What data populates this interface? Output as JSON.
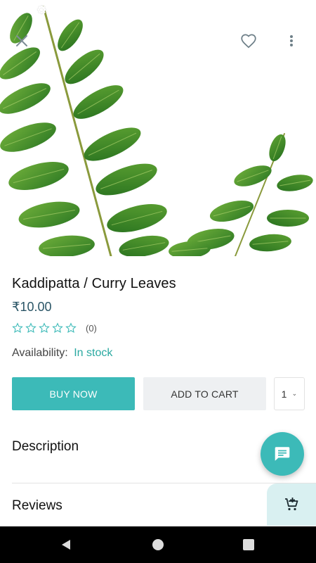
{
  "product": {
    "title": "Kaddipatta / Curry Leaves",
    "price": "₹10.00",
    "rating_count": "(0)",
    "rating_value": 0,
    "rating_max": 5,
    "availability_label": "Availability:",
    "availability_status": "In stock"
  },
  "actions": {
    "buy_now": "BUY NOW",
    "add_to_cart": "ADD TO CART",
    "quantity": "1"
  },
  "sections": {
    "description": "Description",
    "reviews": "Reviews"
  },
  "icons": {
    "top_left": "settings-icon",
    "close": "close-icon",
    "favorite": "heart-outline-icon",
    "menu": "more-vertical-icon",
    "chat": "chat-icon",
    "cart": "add-shopping-cart-icon",
    "nav_back": "back-triangle-icon",
    "nav_home": "home-circle-icon",
    "nav_recent": "recent-square-icon"
  },
  "colors": {
    "accent": "#3cbab8",
    "stock_text": "#2aa9a1",
    "price_text": "#2a5566",
    "secondary_button": "#eef0f2",
    "cart_tab": "#d9f0f1",
    "navbar": "#000000"
  }
}
